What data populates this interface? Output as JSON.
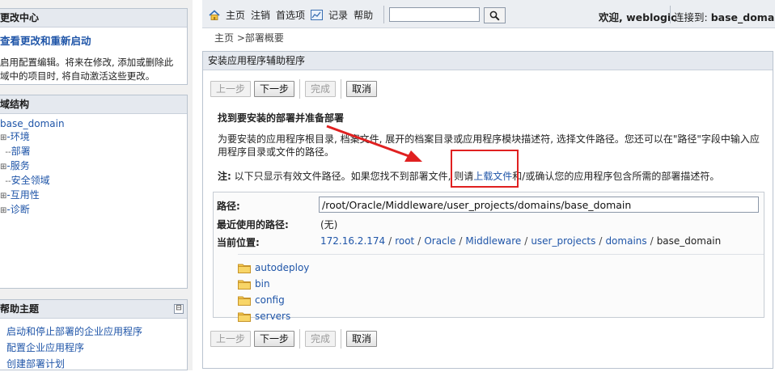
{
  "left": {
    "change_center": {
      "title": "更改中心",
      "view_link": "查看更改和重新启动",
      "description": "启用配置编辑。将来在修改, 添加或删除此域中的项目时, 将自动激活这些更改。"
    },
    "domain_structure": {
      "title": "域结构",
      "root": "base_domain",
      "items": [
        {
          "expander": "⊞",
          "label": "环境"
        },
        {
          "expander": "",
          "label": "部署"
        },
        {
          "expander": "⊞",
          "label": "服务"
        },
        {
          "expander": "",
          "label": "安全领域"
        },
        {
          "expander": "⊞",
          "label": "互用性"
        },
        {
          "expander": "⊞",
          "label": "诊断"
        }
      ]
    },
    "help_topics": {
      "title": "帮助主题",
      "collapse": "⊟",
      "items": [
        "启动和停止部署的企业应用程序",
        "配置企业应用程序",
        "创建部署计划"
      ]
    }
  },
  "topbar": {
    "home": "主页",
    "logout": "注销",
    "preferences": "首选项",
    "record": "记录",
    "help": "帮助",
    "search_value": "",
    "welcome": "欢迎, weblogic",
    "connected_label": "连接到:",
    "connected_domain": "base_domain"
  },
  "breadcrumb": {
    "home": "主页",
    "sep": " >",
    "current": "部署概要"
  },
  "assistant": {
    "title": "安装应用程序辅助程序",
    "buttons": {
      "back": "上一步",
      "next": "下一步",
      "finish": "完成",
      "cancel": "取消"
    },
    "section_title": "找到要安装的部署并准备部署",
    "instructions": "为要安装的应用程序根目录, 档案文件, 展开的档案目录或应用程序模块描述符, 选择文件路径。您还可以在\"路径\"字段中输入应用程序目录或文件的路径。",
    "note_label": "注:",
    "note_before": " 以下只显示有效文件路径。如果您找不到部署文件, 则请",
    "note_link": "上载文件",
    "note_after": "和/或确认您的应用程序包含所需的部署描述符。",
    "path_label": "路径:",
    "path_value": "/root/Oracle/Middleware/user_projects/domains/base_domain",
    "recent_label": "最近使用的路径:",
    "recent_value": "(无)",
    "current_label": "当前位置:",
    "current_location": [
      "172.16.2.174",
      "root",
      "Oracle",
      "Middleware",
      "user_projects",
      "domains"
    ],
    "current_last": "base_domain",
    "folders": [
      "autodeploy",
      "bin",
      "config",
      "servers"
    ]
  },
  "colors": {
    "link": "#1f55a8",
    "annotation": "#e02020",
    "panel_header": "#e5e9ef"
  }
}
